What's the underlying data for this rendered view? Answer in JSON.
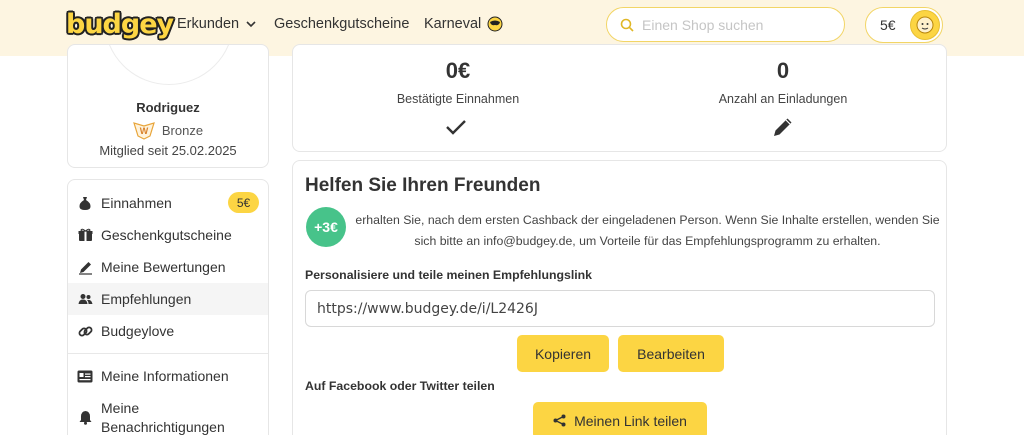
{
  "header": {
    "logo": "budgey",
    "nav": [
      "Erkunden",
      "Geschenkgutscheine",
      "Karneval"
    ],
    "search_placeholder": "Einen Shop suchen",
    "balance": "5€"
  },
  "profile": {
    "name": "Rodriguez",
    "rank": "Bronze",
    "rank_badge": "W",
    "member_since": "Mitglied seit 25.02.2025"
  },
  "sidebar": {
    "items": [
      {
        "label": "Einnahmen",
        "icon": "money-bag-icon",
        "badge": "5€"
      },
      {
        "label": "Geschenkgutscheine",
        "icon": "gift-icon"
      },
      {
        "label": "Meine Bewertungen",
        "icon": "pen-icon"
      },
      {
        "label": "Empfehlungen",
        "icon": "users-icon",
        "active": true
      },
      {
        "label": "Budgeylove",
        "icon": "link-icon"
      },
      {
        "label": "Meine Informationen",
        "icon": "id-card-icon"
      },
      {
        "label": "Meine Benachrichtigungen",
        "icon": "bell-icon"
      }
    ]
  },
  "stats": {
    "confirmed_value": "0€",
    "confirmed_label": "Bestätigte Einnahmen",
    "invites_value": "0",
    "invites_label": "Anzahl an Einladungen"
  },
  "help": {
    "title": "Helfen Sie Ihren Freunden",
    "bonus": "+3€",
    "text": "erhalten Sie, nach dem ersten Cashback der eingeladenen Person. Wenn Sie Inhalte erstellen, wenden Sie sich bitte an info@budgey.de, um Vorteile für das Empfehlungsprogramm zu erhalten.",
    "link_label": "Personalisiere und teile meinen Empfehlungslink",
    "link_value": "https://www.budgey.de/i/L2426J",
    "copy_button": "Kopieren",
    "edit_button": "Bearbeiten",
    "share_label": "Auf Facebook oder Twitter teilen",
    "share_button": "Meinen Link teilen"
  },
  "colors": {
    "accent": "#fcd543",
    "header_bg": "#fdf5e1",
    "bonus_green": "#47c38a"
  }
}
